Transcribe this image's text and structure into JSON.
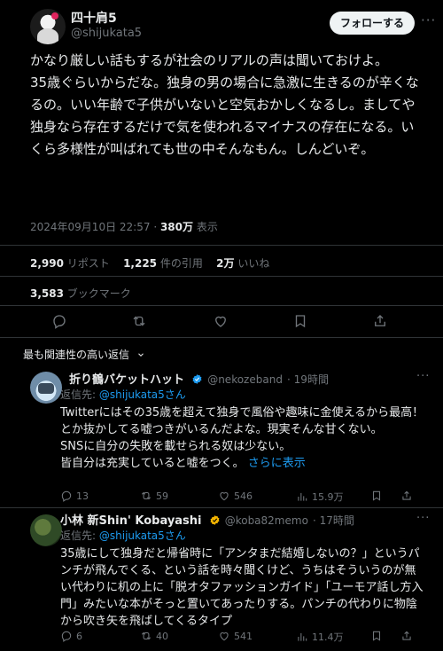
{
  "tweet": {
    "author_name": "四十肩5",
    "author_handle": "@shijukata5",
    "follow_label": "フォローする",
    "paragraphs": [
      "かなり厳しい話もするが社会のリアルの声は聞いておけよ。",
      "35歳ぐらいからだな。独身の男の場合に急激に生きるのが辛くなるの。いい年齢で子供がいないと空気おかしくなるし。ましてや独身なら存在するだけで気を使われるマイナスの存在になる。いくら多様性が叫ばれても世の中そんなもん。しんどいぞ。"
    ],
    "timestamp": "2024年09月10日 22:57",
    "views_count": "380万",
    "views_label": "表示",
    "reposts_count": "2,990",
    "reposts_label": "リポスト",
    "quotes_count": "1,225",
    "quotes_label": "件の引用",
    "likes_count": "2万",
    "likes_label": "いいね",
    "bookmarks_count": "3,583",
    "bookmarks_label": "ブックマーク"
  },
  "replies_header": "最も関連性の高い返信",
  "replies": [
    {
      "author_name": "折り鶴バケットハット",
      "author_handle": "@nekozeband",
      "time": "19時間",
      "reply_to_label": "返信先:",
      "reply_to_handle": "@shijukata5さん",
      "paragraphs": [
        "Twitterにはその35歳を超えて独身で風俗や趣味に金使えるから最高！とか抜かしてる嘘つきがいるんだよな。現実そんな甘くない。",
        "SNSに自分の失敗を載せられる奴は少ない。",
        "皆自分は充実していると嘘をつく。"
      ],
      "show_more": "さらに表示",
      "replies": "13",
      "reposts": "59",
      "likes": "546",
      "views": "15.9万"
    },
    {
      "author_name": "小林 新Shin' Kobayashi",
      "author_handle": "@koba82memo",
      "time": "17時間",
      "reply_to_label": "返信先:",
      "reply_to_handle": "@shijukata5さん",
      "paragraphs": [
        "35歳にして独身だと帰省時に「アンタまだ結婚しないの？」というパンチが飛んでくる、という話を時々聞くけど、うちはそういうのが無い代わりに机の上に「脱オタファッションガイド」「ユーモア話し方入門」みたいな本がそっと置いてあったりする。パンチの代わりに物陰から吹き矢を飛ばしてくるタイプ"
      ],
      "replies": "6",
      "reposts": "40",
      "likes": "541",
      "views": "11.4万"
    }
  ],
  "icons": [
    "more-icon",
    "reply-icon",
    "repost-icon",
    "like-icon",
    "bookmark-icon",
    "share-icon",
    "views-icon",
    "verified-icon",
    "chevron-down-icon"
  ],
  "colors": {
    "background": "#000000",
    "text": "#e7e9ea",
    "muted": "#71767b",
    "link": "#1d9bf0",
    "verified": "#f4b400"
  }
}
